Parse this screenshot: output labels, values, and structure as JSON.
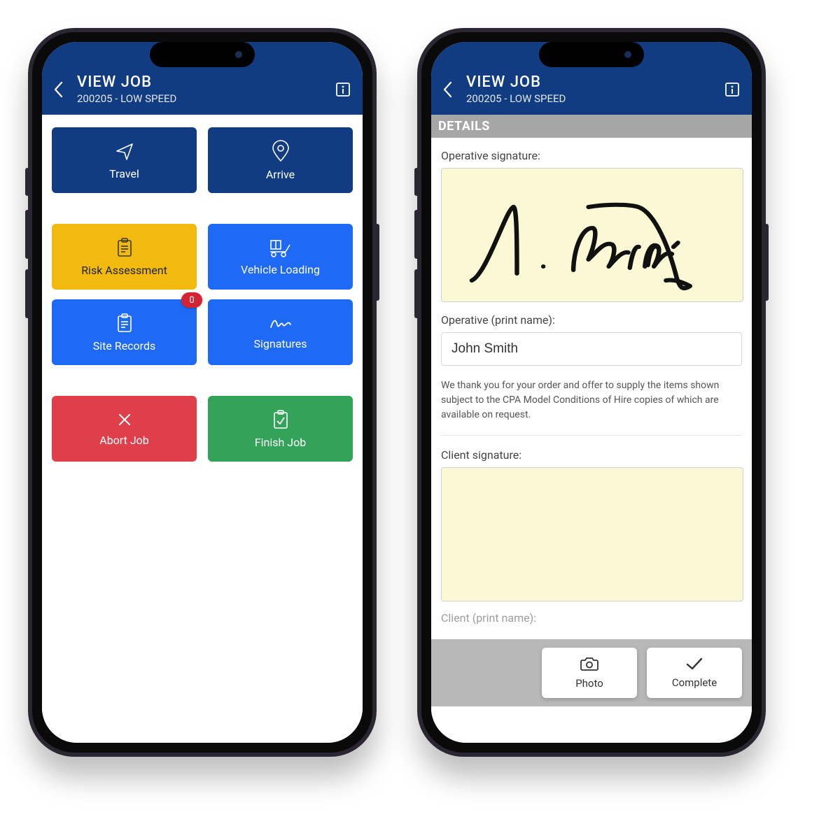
{
  "header": {
    "title": "VIEW JOB",
    "subtitle": "200205 - LOW SPEED"
  },
  "tiles": {
    "travel": "Travel",
    "arrive": "Arrive",
    "risk": "Risk Assessment",
    "vehicle": "Vehicle Loading",
    "site": "Site Records",
    "site_badge": "0",
    "signatures": "Signatures",
    "abort": "Abort Job",
    "finish": "Finish Job"
  },
  "details": {
    "section": "DETAILS",
    "op_sig_label": "Operative signature:",
    "op_name_label": "Operative (print name):",
    "op_name_value": "John Smith",
    "terms": "We thank you for your order and offer to supply the items shown subject to the CPA Model Conditions of Hire copies of which are available on request.",
    "client_sig_label": "Client signature:",
    "client_name_label": "Client (print name):"
  },
  "actions": {
    "photo": "Photo",
    "complete": "Complete"
  }
}
